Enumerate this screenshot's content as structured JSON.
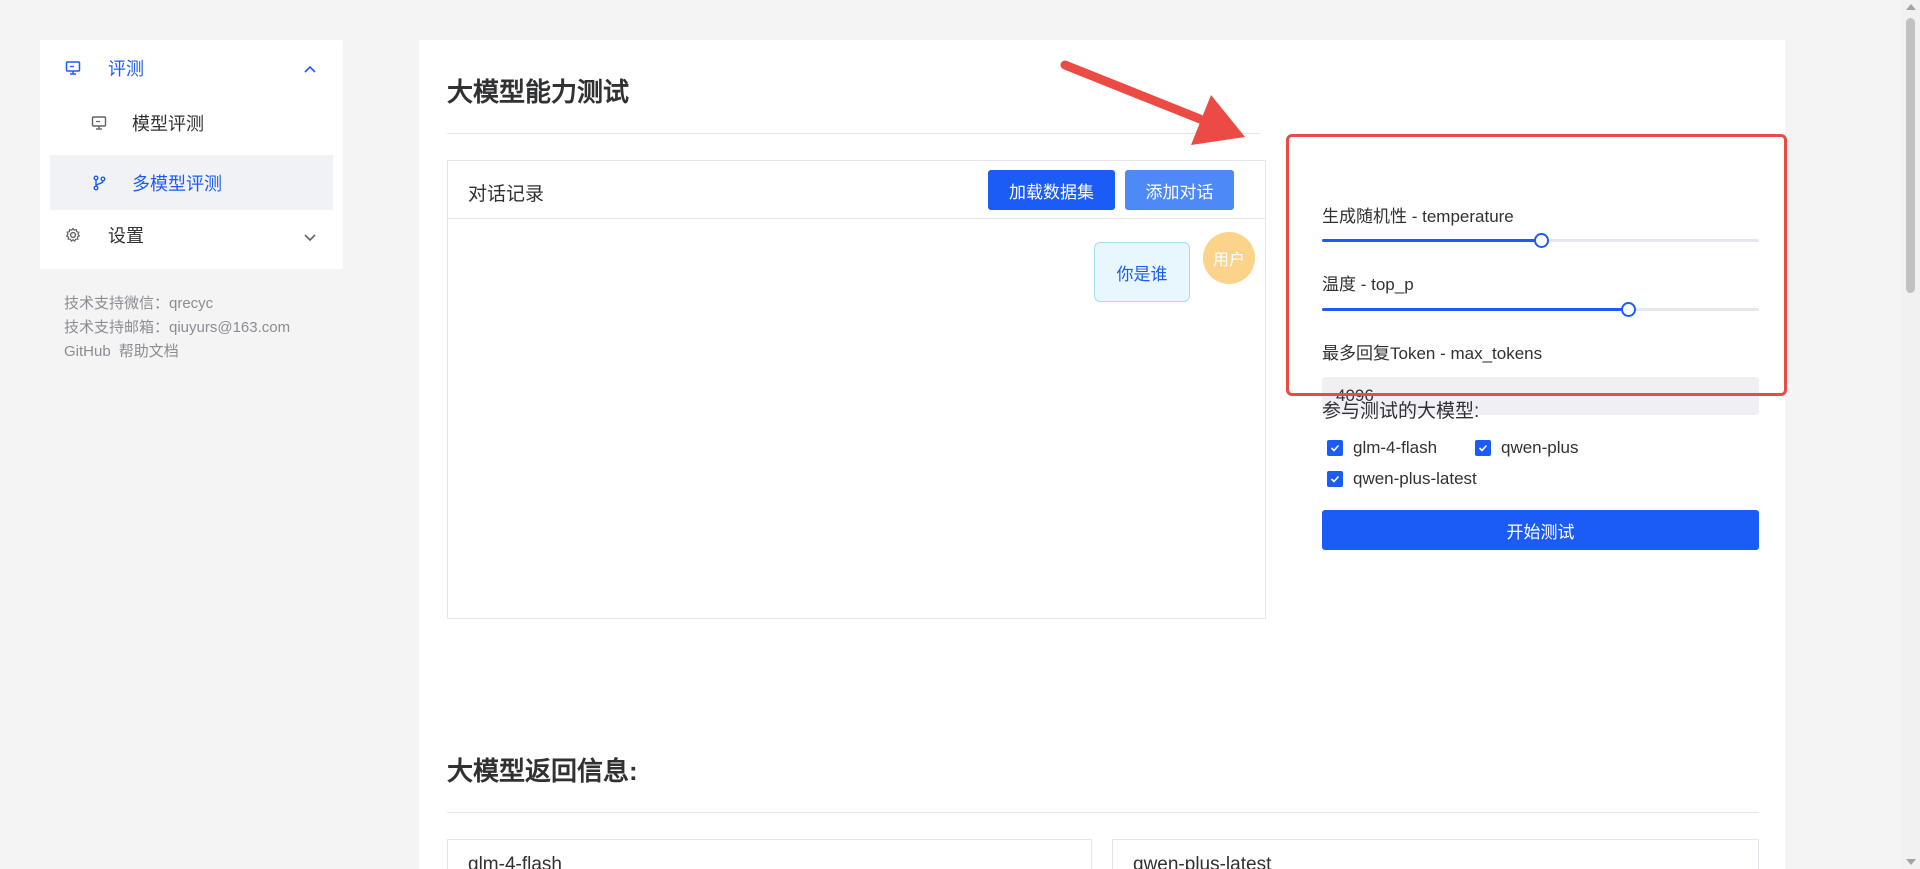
{
  "sidebar": {
    "items": [
      {
        "label": "评测",
        "icon": "monitor-icon",
        "expanded": true
      },
      {
        "label": "模型评测",
        "icon": "monitor-icon"
      },
      {
        "label": "多模型评测",
        "icon": "branch-icon",
        "selected": true
      },
      {
        "label": "设置",
        "icon": "gear-icon",
        "expanded": false
      }
    ],
    "support": {
      "wechat": "技术支持微信：qrecyc",
      "email": "技术支持邮箱：qiuyurs@163.com",
      "github": "GitHub",
      "docs": "帮助文档"
    }
  },
  "main": {
    "title": "大模型能力测试",
    "chat": {
      "title": "对话记录",
      "load_dataset_label": "加载数据集",
      "add_dialog_label": "添加对话",
      "messages": [
        {
          "role": "用户",
          "text": "你是谁"
        }
      ]
    },
    "settings": {
      "temperature_label": "生成随机性 - temperature",
      "temperature_value": 0.5,
      "top_p_label": "温度 - top_p",
      "top_p_value": 0.7,
      "max_tokens_label": "最多回复Token - max_tokens",
      "max_tokens_value": "4096"
    },
    "models": {
      "label": "参与测试的大模型:",
      "options": [
        {
          "name": "glm-4-flash",
          "checked": true
        },
        {
          "name": "qwen-plus",
          "checked": true
        },
        {
          "name": "qwen-plus-latest",
          "checked": true
        }
      ]
    },
    "start_label": "开始测试",
    "results": {
      "title": "大模型返回信息:",
      "cards": [
        "glm-4-flash",
        "qwen-plus-latest"
      ]
    }
  },
  "colors": {
    "accent": "#1c5cf6",
    "accent_light": "#4d8af7",
    "annotation_red": "#eb4a45",
    "avatar": "#fcd38a"
  }
}
